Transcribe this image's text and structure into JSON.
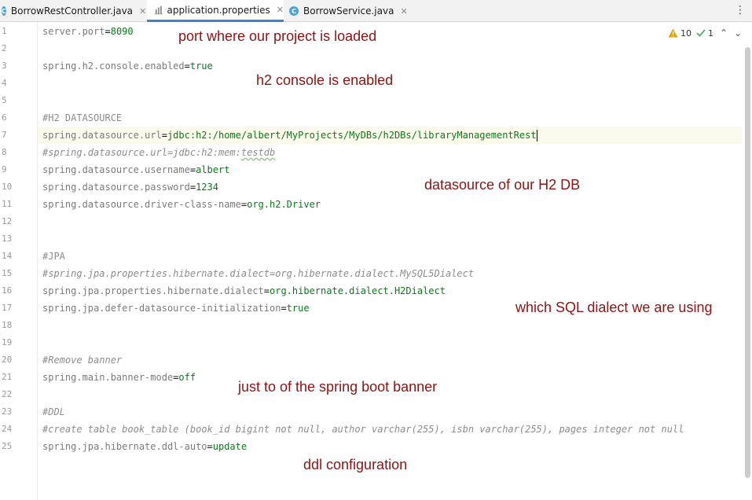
{
  "tabs": [
    {
      "name": "BorrowRestController.java",
      "icon": "java-class-icon",
      "icon_glyph": "C",
      "active": false
    },
    {
      "name": "application.properties",
      "icon": "properties-file-icon",
      "active": true
    },
    {
      "name": "BorrowService.java",
      "icon": "java-class-icon",
      "icon_glyph": "C",
      "active": false
    }
  ],
  "tab_close_glyph": "✕",
  "menu_glyph": "⋮",
  "inspections": {
    "warnings": "10",
    "weak_warnings": "1",
    "up_glyph": "⌃",
    "down_glyph": "⌄"
  },
  "line_numbers": [
    "1",
    "2",
    "3",
    "4",
    "5",
    "6",
    "7",
    "8",
    "9",
    "10",
    "11",
    "12",
    "13",
    "14",
    "15",
    "16",
    "17",
    "18",
    "19",
    "20",
    "21",
    "22",
    "23",
    "24",
    "25"
  ],
  "code": {
    "l1": {
      "key": "server.port",
      "eq": "=",
      "value": "8090"
    },
    "l3": {
      "key": "spring.h2.console.enabled",
      "eq": "=",
      "value": "true"
    },
    "l6": {
      "comment": "#H2 DATASOURCE"
    },
    "l7": {
      "key": "spring.datasource.url",
      "eq": "=",
      "value": "jdbc:h2:/home/albert/MyProjects/MyDBs/h2DBs/libraryManagementRest"
    },
    "l8": {
      "comment_prefix": "#spring.datasource.url=jdbc:h2:mem:",
      "comment_squig": "testdb"
    },
    "l9": {
      "key": "spring.datasource.username",
      "eq": "=",
      "value": "albert"
    },
    "l10": {
      "key": "spring.datasource.password",
      "eq": "=",
      "value": "1234"
    },
    "l11": {
      "key": "spring.datasource.driver-class-name",
      "eq": "=",
      "value": "org.h2.Driver"
    },
    "l14": {
      "comment": "#JPA"
    },
    "l15": {
      "comment": "#spring.jpa.properties.hibernate.dialect=org.hibernate.dialect.MySQL5Dialect"
    },
    "l16": {
      "key": "spring.jpa.properties.hibernate.dialect",
      "eq": "=",
      "value": "org.hibernate.dialect.H2Dialect"
    },
    "l17": {
      "key": "spring.jpa.defer-datasource-initialization",
      "eq": "=",
      "value": "true"
    },
    "l20": {
      "comment": "#Remove banner"
    },
    "l21": {
      "key": "spring.main.banner-mode",
      "eq": "=",
      "value": "off"
    },
    "l23": {
      "comment": "#DDL"
    },
    "l24": {
      "comment": "#create table book_table (book_id bigint not null, author varchar(255), isbn varchar(255), pages integer not null"
    },
    "l25": {
      "key": "spring.jpa.hibernate.ddl-auto",
      "eq": "=",
      "value": "update"
    }
  },
  "annotations": {
    "port": "port where our project is loaded",
    "h2console": "h2 console is enabled",
    "datasource": "datasource of our H2 DB",
    "dialect": "which SQL dialect we are using",
    "banner": "just to of the spring boot banner",
    "ddl": "ddl configuration"
  },
  "colors": {
    "annotation": "#8b1414",
    "key": "#7b7b7b",
    "value": "#067d17",
    "comment": "#8c8c8c",
    "active_tab_underline": "#4083c9"
  }
}
